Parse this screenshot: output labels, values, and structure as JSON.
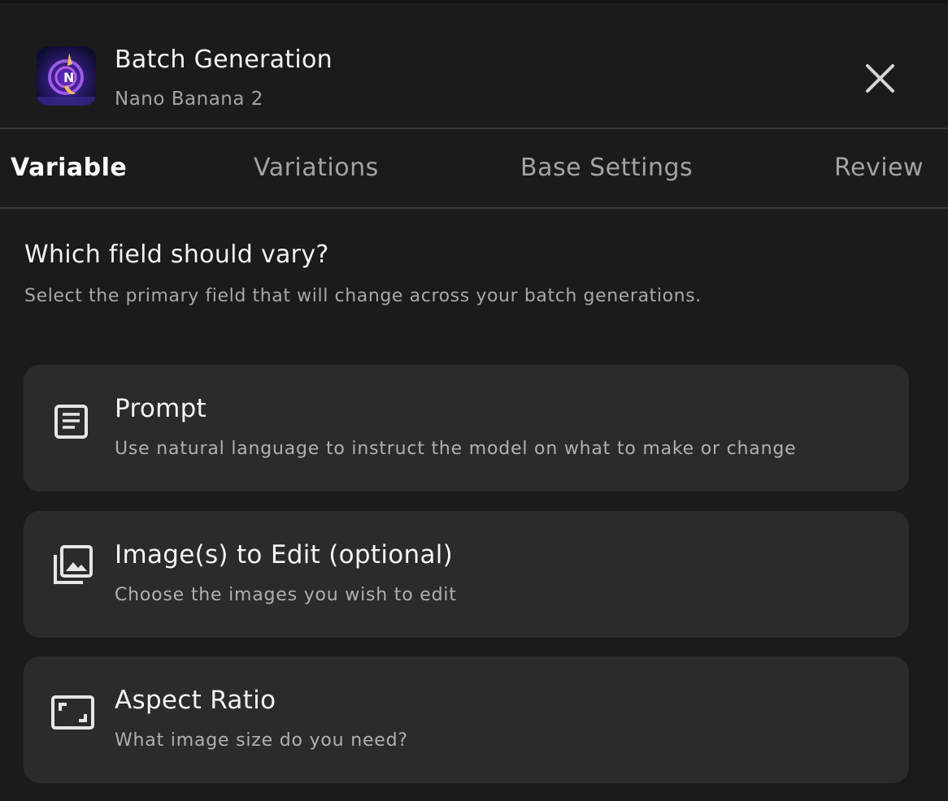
{
  "header": {
    "title": "Batch Generation",
    "subtitle": "Nano Banana 2"
  },
  "tabs": [
    {
      "label": "Variable",
      "active": true
    },
    {
      "label": "Variations",
      "active": false
    },
    {
      "label": "Base Settings",
      "active": false
    },
    {
      "label": "Review",
      "active": false
    }
  ],
  "main": {
    "heading": "Which field should vary?",
    "description": "Select the primary field that will change across your batch generations.",
    "options": [
      {
        "icon": "document-icon",
        "title": "Prompt",
        "description": "Use natural language to instruct the model on what to make or change"
      },
      {
        "icon": "image-stack-icon",
        "title": "Image(s) to Edit (optional)",
        "description": "Choose the images you wish to edit"
      },
      {
        "icon": "aspect-ratio-icon",
        "title": "Aspect Ratio",
        "description": "What image size do you need?"
      }
    ]
  },
  "colors": {
    "background": "#1b1b1b",
    "card": "#2b2b2b",
    "divider": "#3a3a3a"
  }
}
